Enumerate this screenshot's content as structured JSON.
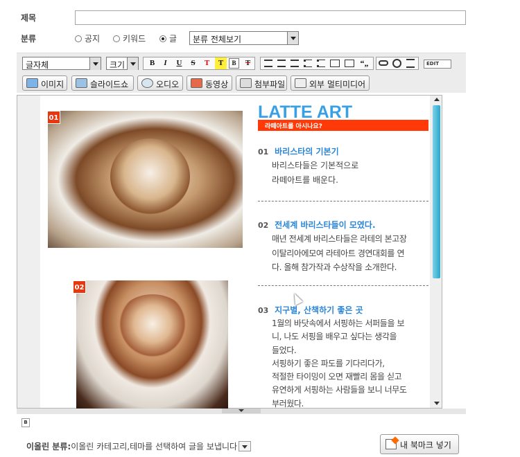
{
  "form": {
    "title_label": "제목",
    "title_value": "",
    "category_label": "분류",
    "radio_notice": "공지",
    "radio_keyword": "키워드",
    "radio_post": "글",
    "category_select": "분류 전체보기"
  },
  "toolbar": {
    "font_select": "글자체",
    "size_select": "크기",
    "bold": "B",
    "italic": "I",
    "underline": "U",
    "strike": "S",
    "text_color": "T",
    "bg_color": "T",
    "box": "B",
    "clear_format": "T",
    "quote": "“„",
    "edit_mode": "EDIT"
  },
  "media_buttons": {
    "image": "이미지",
    "slideshow": "슬라이드쇼",
    "audio": "오디오",
    "video": "동영상",
    "attachment": "첨부파일",
    "external_media": "외부 멀티미디어"
  },
  "content": {
    "badge1": "01",
    "badge2": "02",
    "headline": "LATTE ART",
    "subheadline": "라떼아트를 아시나요?",
    "sections": [
      {
        "num": "01",
        "title": "바리스타의 기본기",
        "lines": [
          "바리스타들은 기본적으로",
          "라떼아트를 배운다."
        ]
      },
      {
        "num": "02",
        "title": "전세계 바리스타들이 모였다.",
        "lines": [
          "매년 전세계 바리스타들은 라테의 본고장",
          "이탈리아에모여 라테아트 경연대회를 연",
          "다. 올해 참가작과 수상작을 소개한다."
        ]
      },
      {
        "num": "03",
        "title": "지구별, 산책하기 좋은 곳",
        "lines": [
          "1월의 바닷속에서 서핑하는 서퍼들을 보",
          "니, 나도 서핑을 배우고 싶다는 생각을",
          "들었다.",
          "서핑하기 좋은 파도를 기다리다가,",
          "적절한 타이밍이 오면 재빨리 몸을 싣고",
          "유연하게 서핑하는 사람들을 보니 너무도",
          "부러웠다."
        ]
      }
    ]
  },
  "footer": {
    "post_category_label": "이올린 분류:",
    "post_category_text": "이올린 카테고리,테마를 선택하여 글을 보냅니다",
    "bookmark_button": "내 북마크 넣기"
  },
  "colors": {
    "accent_blue": "#3aa0e6",
    "accent_red": "#ff3a08",
    "scroll_thumb": "#29a7cf"
  }
}
